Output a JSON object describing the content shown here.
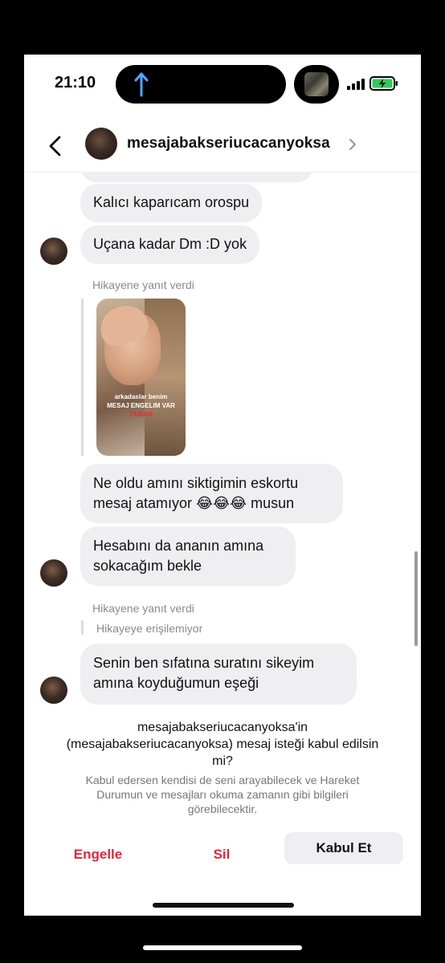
{
  "status_bar": {
    "time": "21:10"
  },
  "header": {
    "username": "mesajabakseriucacanyoksa"
  },
  "messages": [
    {
      "text": "Kalıcı kaparıcam orospu"
    },
    {
      "text": "Uçana kadar Dm :D yok"
    },
    {
      "line1": "Ne oldu amını siktigimin eskortu",
      "line2": "mesaj atamıyor 😂😂😂 musun"
    },
    {
      "line1": "Hesabını da ananın amına",
      "line2": "sokacağım bekle"
    },
    {
      "line1": "Senin ben sıfatına suratını sikeyim",
      "line2": "amına koyduğumun eşeği"
    }
  ],
  "story_replies": {
    "label_1": "Hikayene yanıt verdi",
    "label_2": "Hikayene yanıt verdi",
    "unavailable": "Hikayeye erişilemiyor",
    "thumb_text_1": "arkadaslar benim",
    "thumb_text_2": "MESAJ ENGELIM VAR",
    "thumb_text_3": "TAMAM"
  },
  "request": {
    "title_line1": "mesajabakseriucacanyoksa'in",
    "title_line2": "(mesajabakseriucacanyoksa) mesaj isteği kabul edilsin",
    "title_line3": "mi?",
    "desc_line1": "Kabul edersen kendisi de seni arayabilecek ve Hareket",
    "desc_line2": "Durumun ve mesajları okuma zamanın gibi bilgileri",
    "desc_line3": "görebilecektir.",
    "block_label": "Engelle",
    "delete_label": "Sil",
    "accept_label": "Kabul Et"
  },
  "colors": {
    "danger": "#e0273a",
    "bubble": "#efeff1",
    "battery_fill": "#34c759"
  }
}
